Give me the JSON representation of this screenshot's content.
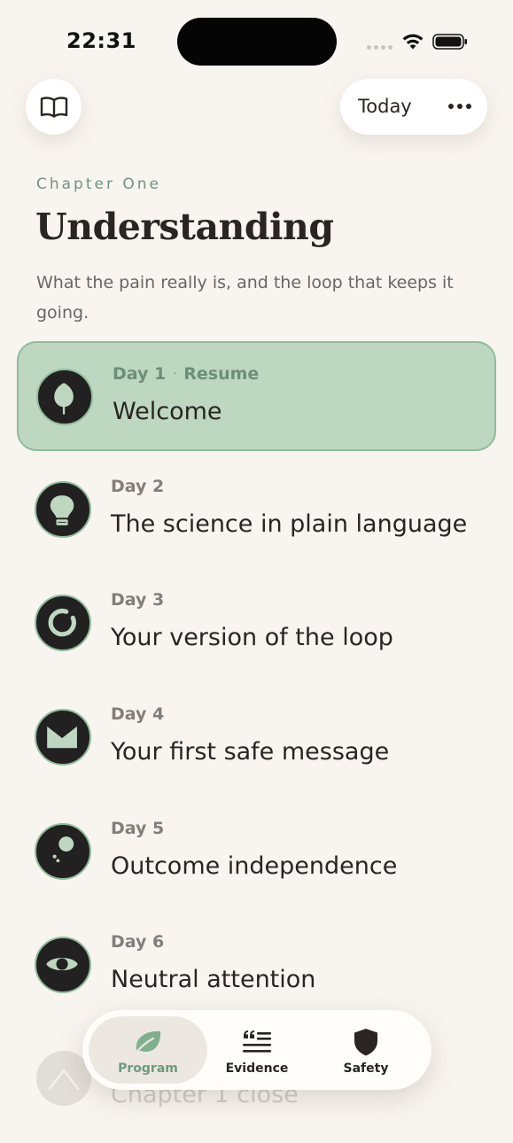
{
  "status_bar": {
    "time": "22:31"
  },
  "header": {
    "today_label": "Today"
  },
  "chapter": {
    "label": "Chapter One",
    "title": "Understanding",
    "description": "What the pain really is, and the loop that keeps it going."
  },
  "days": [
    {
      "day": "Day 1",
      "status": "Resume",
      "title": "Welcome",
      "icon": "leaf-icon",
      "active": true
    },
    {
      "day": "Day 2",
      "status": "",
      "title": "The science in plain language",
      "icon": "lightbulb-icon",
      "active": false
    },
    {
      "day": "Day 3",
      "status": "",
      "title": "Your version of the loop",
      "icon": "loop-icon",
      "active": false
    },
    {
      "day": "Day 4",
      "status": "",
      "title": "Your first safe message",
      "icon": "envelope-icon",
      "active": false
    },
    {
      "day": "Day 5",
      "status": "",
      "title": "Outcome independence",
      "icon": "thought-bubble-icon",
      "active": false
    },
    {
      "day": "Day 6",
      "status": "",
      "title": "Neutral attention",
      "icon": "eye-icon",
      "active": false
    }
  ],
  "chapter_close": {
    "title": "Chapter 1 close",
    "icon": "mountain-icon"
  },
  "tabs": [
    {
      "label": "Program",
      "icon": "leaf-icon",
      "active": true
    },
    {
      "label": "Evidence",
      "icon": "quote-list-icon",
      "active": false
    },
    {
      "label": "Safety",
      "icon": "shield-icon",
      "active": false
    }
  ],
  "colors": {
    "background": "#f8f4ef",
    "accent_green": "#8fbd9b",
    "active_card": "#bdd7c1",
    "icon_dark": "#222020",
    "text": "#2a2523"
  }
}
